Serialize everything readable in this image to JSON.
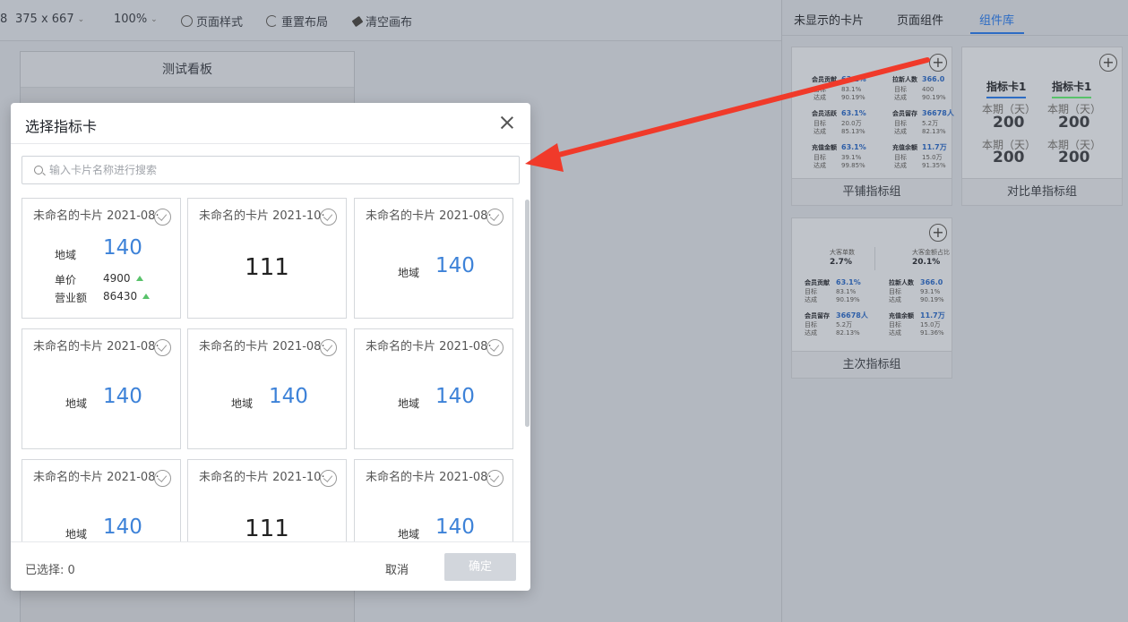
{
  "toolbar": {
    "size_value": "375 x 667",
    "zoom": "100%",
    "page_style": "页面样式",
    "reset_layout": "重置布局",
    "clear_canvas": "清空画布",
    "left_fragment": "8"
  },
  "canvas": {
    "board_title": "测试看板"
  },
  "right_panel": {
    "tabs": [
      "未显示的卡片",
      "页面组件",
      "组件库"
    ],
    "active_tab": "组件库",
    "library": [
      {
        "label": "平铺指标组"
      },
      {
        "label": "对比单指标组"
      },
      {
        "label": "主次指标组"
      }
    ],
    "tiled_preview": {
      "items": [
        {
          "name": "会员贡献",
          "value": "63.1%",
          "r1": "目标",
          "r1v": "83.1%",
          "r2": "达成",
          "r2v": "90.19%"
        },
        {
          "name": "拉新人数",
          "value": "366.0",
          "r1": "目标",
          "r1v": "400",
          "r2": "达成",
          "r2v": "90.19%"
        },
        {
          "name": "会员活跃",
          "value": "63.1%",
          "r1": "目标",
          "r1v": "20.0万",
          "r2": "达成",
          "r2v": "85.13%"
        },
        {
          "name": "会员留存",
          "value": "36678人",
          "r1": "目标",
          "r1v": "5.2万",
          "r2": "达成",
          "r2v": "82.13%"
        },
        {
          "name": "充值金额",
          "value": "63.1%",
          "r1": "目标",
          "r1v": "39.1%",
          "r2": "达成",
          "r2v": "99.85%"
        },
        {
          "name": "充值余额",
          "value": "11.7万",
          "r1": "目标",
          "r1v": "15.0万",
          "r2": "达成",
          "r2v": "91.35%"
        }
      ]
    },
    "compare_preview": {
      "tabs": [
        "指标卡1",
        "指标卡1"
      ],
      "period_label": "本期（天）",
      "value": "200"
    },
    "primary_preview": {
      "top": [
        {
          "name": "大客单数",
          "value": "2.7%"
        },
        {
          "name": "大客金额占比",
          "value": "20.1%"
        }
      ],
      "items": [
        {
          "name": "会员贡献",
          "value": "63.1%",
          "r1": "目标",
          "r1v": "83.1%",
          "r2": "达成",
          "r2v": "90.19%"
        },
        {
          "name": "拉新人数",
          "value": "366.0",
          "r1": "目标",
          "r1v": "93.1%",
          "r2": "达成",
          "r2v": "90.19%"
        },
        {
          "name": "会员留存",
          "value": "36678人",
          "r1": "目标",
          "r1v": "5.2万",
          "r2": "达成",
          "r2v": "82.13%"
        },
        {
          "name": "充值余额",
          "value": "11.7万",
          "r1": "目标",
          "r1v": "15.0万",
          "r2": "达成",
          "r2v": "91.36%"
        }
      ]
    }
  },
  "modal": {
    "title": "选择指标卡",
    "search_placeholder": "输入卡片名称进行搜索",
    "cards": [
      {
        "title": "未命名的卡片 2021-08··",
        "type": "detail",
        "label": "地域",
        "value": "140",
        "subs": [
          {
            "label": "单价",
            "value": "4900"
          },
          {
            "label": "营业额",
            "value": "86430"
          }
        ]
      },
      {
        "title": "未命名的卡片 2021-10··",
        "type": "big",
        "value": "111"
      },
      {
        "title": "未命名的卡片 2021-08··",
        "type": "kv",
        "label": "地域",
        "value": "140"
      },
      {
        "title": "未命名的卡片 2021-08··",
        "type": "kv",
        "label": "地域",
        "value": "140"
      },
      {
        "title": "未命名的卡片 2021-08··",
        "type": "kv",
        "label": "地域",
        "value": "140"
      },
      {
        "title": "未命名的卡片 2021-08··",
        "type": "kv",
        "label": "地域",
        "value": "140"
      },
      {
        "title": "未命名的卡片 2021-08··",
        "type": "kv",
        "label": "地域",
        "value": "140"
      },
      {
        "title": "未命名的卡片 2021-10··",
        "type": "big",
        "value": "111"
      },
      {
        "title": "未命名的卡片 2021-08··",
        "type": "kv",
        "label": "地域",
        "value": "140"
      }
    ],
    "selected_label": "已选择: 0",
    "cancel_label": "取消",
    "ok_label": "确定"
  },
  "colors": {
    "accent": "#3d82d8",
    "tab_active": "#2d6cc4",
    "arrow": "#f03a2a",
    "up_indicator": "#58c26a"
  }
}
